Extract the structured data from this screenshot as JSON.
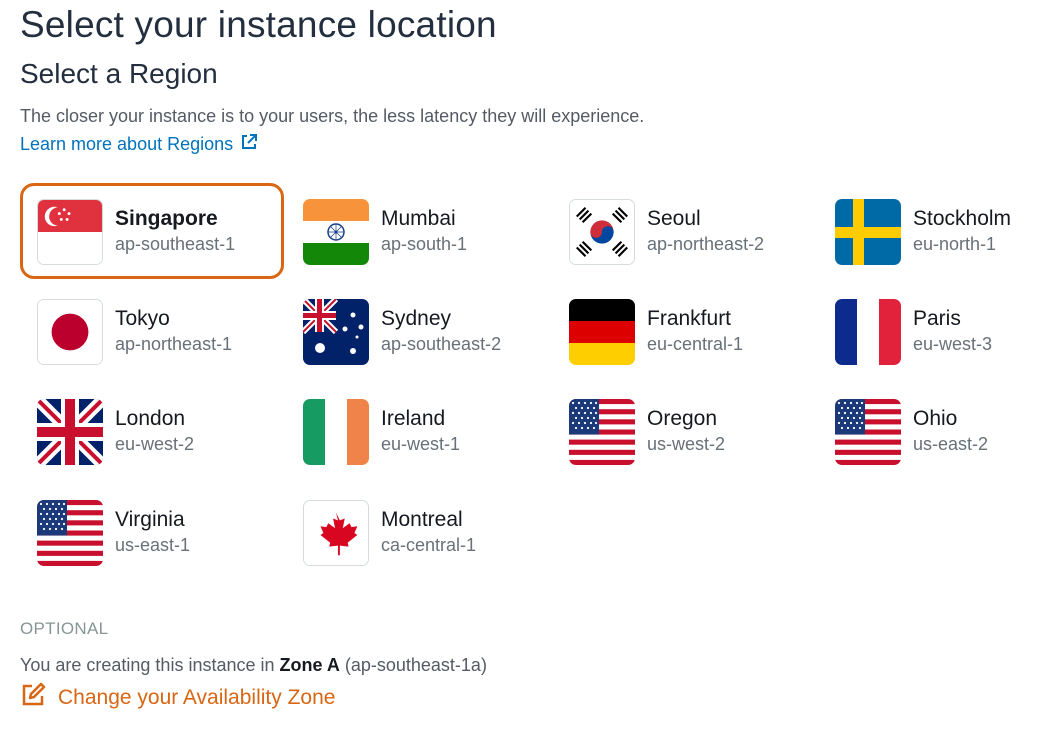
{
  "page_title": "Select your instance location",
  "section_title": "Select a Region",
  "description": "The closer your instance is to your users, the less latency they will experience.",
  "learn_more_link": "Learn more about Regions",
  "regions": [
    {
      "city": "Singapore",
      "code": "ap-southeast-1",
      "flag": "singapore-flag",
      "selected": true
    },
    {
      "city": "Mumbai",
      "code": "ap-south-1",
      "flag": "india-flag"
    },
    {
      "city": "Seoul",
      "code": "ap-northeast-2",
      "flag": "south-korea-flag"
    },
    {
      "city": "Stockholm",
      "code": "eu-north-1",
      "flag": "sweden-flag"
    },
    {
      "city": "Tokyo",
      "code": "ap-northeast-1",
      "flag": "japan-flag"
    },
    {
      "city": "Sydney",
      "code": "ap-southeast-2",
      "flag": "australia-flag"
    },
    {
      "city": "Frankfurt",
      "code": "eu-central-1",
      "flag": "germany-flag"
    },
    {
      "city": "Paris",
      "code": "eu-west-3",
      "flag": "france-flag"
    },
    {
      "city": "London",
      "code": "eu-west-2",
      "flag": "uk-flag"
    },
    {
      "city": "Ireland",
      "code": "eu-west-1",
      "flag": "ireland-flag"
    },
    {
      "city": "Oregon",
      "code": "us-west-2",
      "flag": "usa-flag"
    },
    {
      "city": "Ohio",
      "code": "us-east-2",
      "flag": "usa-flag"
    },
    {
      "city": "Virginia",
      "code": "us-east-1",
      "flag": "usa-flag"
    },
    {
      "city": "Montreal",
      "code": "ca-central-1",
      "flag": "canada-flag"
    }
  ],
  "optional_label": "OPTIONAL",
  "zone": {
    "prefix": "You are creating this instance in",
    "zone_name": "Zone A",
    "zone_code": "(ap-southeast-1a)"
  },
  "change_zone_link": "Change your Availability Zone",
  "colors": {
    "accent_orange": "#d86613",
    "link_blue": "#0073bb",
    "muted_text": "#687078"
  }
}
